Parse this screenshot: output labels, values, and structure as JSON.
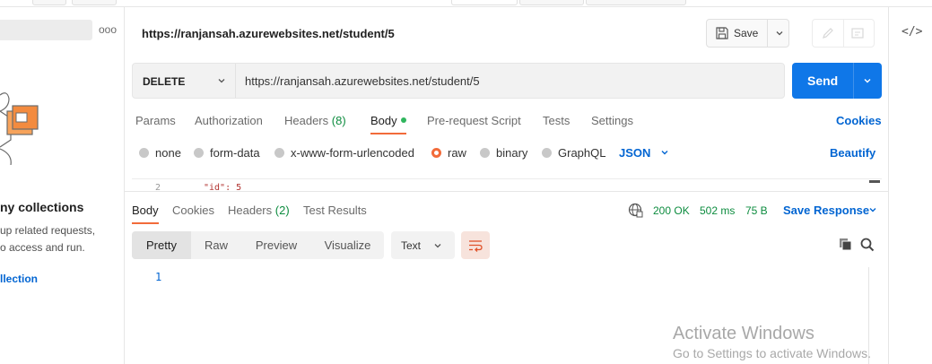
{
  "sidebar": {
    "more": "ooo",
    "empty_title": "ny collections",
    "empty_desc_1": "up related requests,",
    "empty_desc_2": "o access and run.",
    "create_link": "llection"
  },
  "request": {
    "title": "https://ranjansah.azurewebsites.net/student/5",
    "save_label": "Save",
    "method": "DELETE",
    "url": "https://ranjansah.azurewebsites.net/student/5",
    "send_label": "Send"
  },
  "request_tabs": {
    "params": "Params",
    "authorization": "Authorization",
    "headers": "Headers",
    "headers_count": "(8)",
    "body": "Body",
    "prerequest": "Pre-request Script",
    "tests": "Tests",
    "settings": "Settings",
    "cookies": "Cookies"
  },
  "body_types": {
    "none": "none",
    "form_data": "form-data",
    "urlencoded": "x-www-form-urlencoded",
    "raw": "raw",
    "binary": "binary",
    "graphql": "GraphQL",
    "language": "JSON",
    "beautify": "Beautify",
    "selected": "raw"
  },
  "editor": {
    "line_number": "2",
    "code": "\"id\": 5"
  },
  "response": {
    "tabs": {
      "body": "Body",
      "cookies": "Cookies",
      "headers": "Headers",
      "headers_count": "(2)",
      "test_results": "Test Results"
    },
    "status": "200 OK",
    "time": "502 ms",
    "size": "75 B",
    "save_response": "Save Response",
    "views": {
      "pretty": "Pretty",
      "raw": "Raw",
      "preview": "Preview",
      "visualize": "Visualize"
    },
    "format": "Text",
    "line_number": "1"
  },
  "watermark": {
    "line1": "Activate Windows",
    "line2": "Go to Settings to activate Windows."
  },
  "colors": {
    "accent": "#f26b3a",
    "primary": "#0f77e8",
    "link": "#0265d2",
    "success": "#0d8c3f"
  },
  "icons": [
    "save-icon",
    "chevron-down-icon",
    "pencil-icon",
    "document-icon",
    "code-icon",
    "globe-icon",
    "wrap-lines-icon",
    "copy-icon",
    "search-icon",
    "collections-illustration"
  ]
}
